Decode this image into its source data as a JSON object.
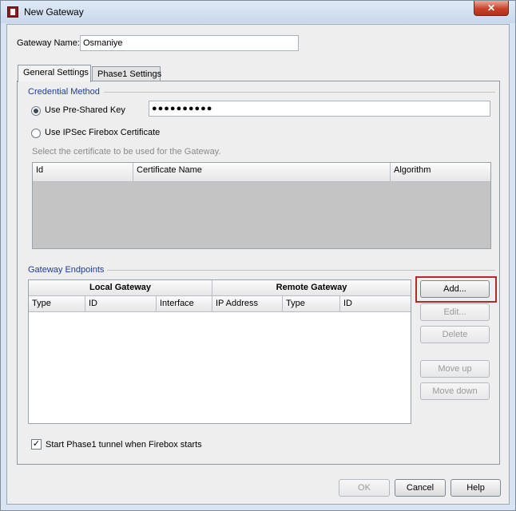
{
  "window": {
    "title": "New Gateway",
    "close_glyph": "✕"
  },
  "gateway_name": {
    "label": "Gateway Name:",
    "value": "Osmaniye"
  },
  "tabs": [
    {
      "label": "General Settings",
      "active": true
    },
    {
      "label": "Phase1 Settings",
      "active": false
    }
  ],
  "credential_method": {
    "title": "Credential Method",
    "pre_shared_label": "Use Pre-Shared Key",
    "pre_shared_selected": true,
    "pre_shared_value": "●●●●●●●●●●",
    "certificate_label": "Use IPSec Firebox Certificate",
    "certificate_selected": false,
    "certificate_hint": "Select the certificate to be used for the Gateway.",
    "cert_columns": [
      "Id",
      "Certificate Name",
      "Algorithm"
    ]
  },
  "gateway_endpoints": {
    "title": "Gateway Endpoints",
    "group_local": "Local Gateway",
    "group_remote": "Remote Gateway",
    "columns": [
      "Type",
      "ID",
      "Interface",
      "IP Address",
      "Type",
      "ID"
    ]
  },
  "side_buttons": {
    "add": "Add...",
    "edit": "Edit...",
    "delete": "Delete",
    "move_up": "Move up",
    "move_down": "Move down"
  },
  "start_phase1": {
    "label": "Start Phase1 tunnel when Firebox starts",
    "checked": true,
    "check_glyph": "✓"
  },
  "footer": {
    "ok": "OK",
    "cancel": "Cancel",
    "help": "Help"
  },
  "icons": {
    "app": "watchguard-gateway-icon",
    "close": "close-icon",
    "checkmark": "checkmark-icon"
  },
  "colors": {
    "section_title": "#1b3d9c",
    "highlight": "#b22a2a",
    "close_button": "#c9422a"
  }
}
